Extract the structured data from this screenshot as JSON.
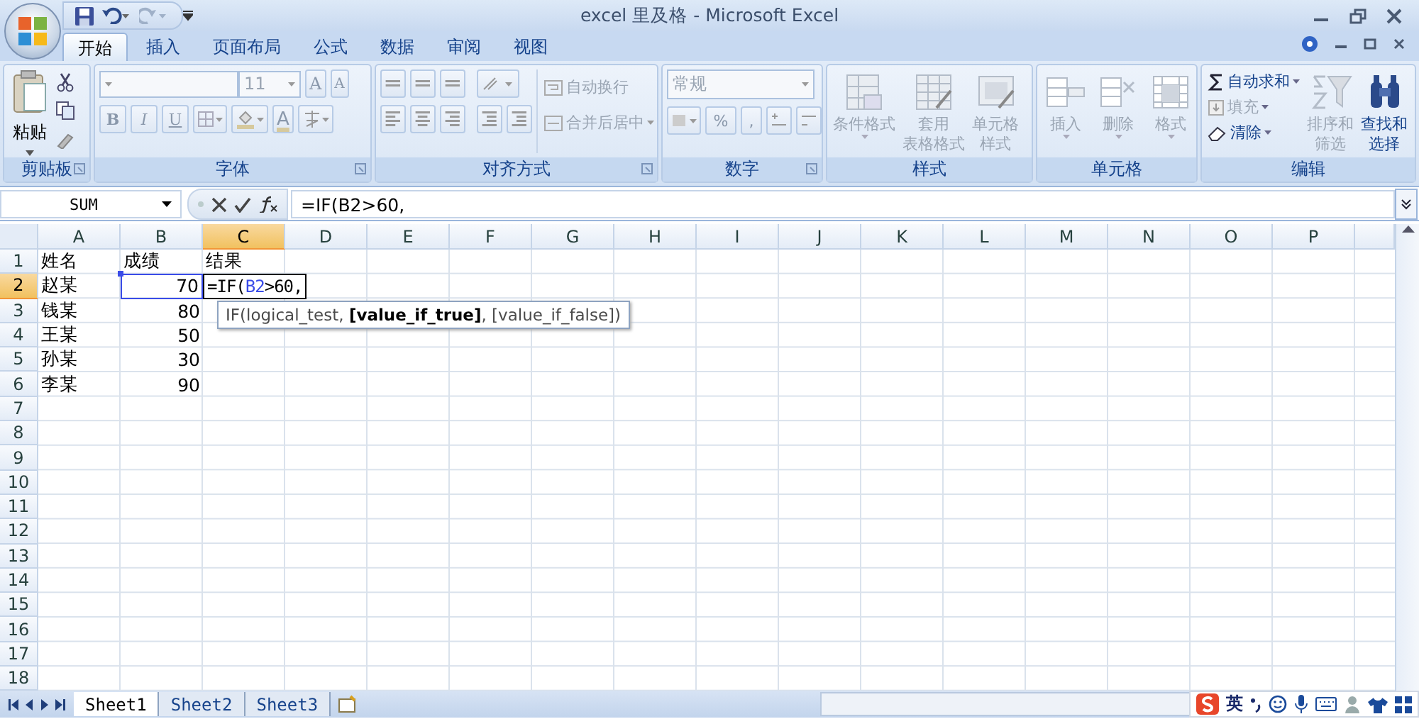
{
  "window": {
    "title": "excel 里及格 - Microsoft Excel"
  },
  "tabs": [
    {
      "label": "开始",
      "selected": true
    },
    {
      "label": "插入",
      "selected": false
    },
    {
      "label": "页面布局",
      "selected": false
    },
    {
      "label": "公式",
      "selected": false
    },
    {
      "label": "数据",
      "selected": false
    },
    {
      "label": "审阅",
      "selected": false
    },
    {
      "label": "视图",
      "selected": false
    }
  ],
  "ribbon": [
    {
      "kind": "clipboard",
      "title": "剪贴板",
      "paste": "粘贴"
    },
    {
      "kind": "font",
      "title": "字体",
      "font_size": "11",
      "size_buttons": [
        "A",
        "A"
      ],
      "style_buttons": [
        "B",
        "I",
        "U"
      ],
      "font_color": "A"
    },
    {
      "kind": "alignment",
      "title": "对齐方式",
      "wrap": {
        "label": "自动换行",
        "disabled": true
      },
      "merge": {
        "label": "合并后居中",
        "disabled": true
      }
    },
    {
      "kind": "number",
      "title": "数字",
      "format": "常规",
      "buttons": [
        "%",
        ","
      ]
    },
    {
      "kind": "large",
      "title": "样式",
      "items": [
        {
          "lines": [
            "条件格式"
          ],
          "disabled": true
        },
        {
          "lines": [
            "套用",
            "表格格式"
          ],
          "disabled": true
        },
        {
          "lines": [
            "单元格",
            "样式"
          ],
          "disabled": true
        }
      ]
    },
    {
      "kind": "large",
      "title": "单元格",
      "items": [
        {
          "lines": [
            "插入"
          ],
          "disabled": true
        },
        {
          "lines": [
            "删除"
          ],
          "disabled": true
        },
        {
          "lines": [
            "格式"
          ],
          "disabled": true
        }
      ]
    },
    {
      "kind": "editing",
      "title": "编辑",
      "small": [
        {
          "label": "自动求和",
          "disabled": false
        },
        {
          "label": "填充",
          "disabled": true
        },
        {
          "label": "清除",
          "disabled": false
        }
      ],
      "large": [
        {
          "lines": [
            "排序和",
            "筛选"
          ],
          "disabled": true
        },
        {
          "lines": [
            "查找和",
            "选择"
          ],
          "disabled": false
        }
      ]
    }
  ],
  "formula_bar": {
    "name_box": "SUM",
    "formula": "=IF(B2>60,"
  },
  "columns": [
    {
      "label": "A",
      "selected": false
    },
    {
      "label": "B",
      "selected": false
    },
    {
      "label": "C",
      "selected": true
    },
    {
      "label": "D",
      "selected": false
    },
    {
      "label": "E",
      "selected": false
    },
    {
      "label": "F",
      "selected": false
    },
    {
      "label": "G",
      "selected": false
    },
    {
      "label": "H",
      "selected": false
    },
    {
      "label": "I",
      "selected": false
    },
    {
      "label": "J",
      "selected": false
    },
    {
      "label": "K",
      "selected": false
    },
    {
      "label": "L",
      "selected": false
    },
    {
      "label": "M",
      "selected": false
    },
    {
      "label": "N",
      "selected": false
    },
    {
      "label": "O",
      "selected": false
    },
    {
      "label": "P",
      "selected": false
    }
  ],
  "rows": [
    {
      "number": "1",
      "selected": false,
      "cells": [
        {
          "kind": "text",
          "text": "姓名"
        },
        {
          "kind": "text",
          "text": "成绩"
        },
        {
          "kind": "text",
          "text": "结果"
        }
      ]
    },
    {
      "number": "2",
      "selected": true,
      "cells": [
        {
          "kind": "text",
          "text": "赵某"
        },
        {
          "kind": "number",
          "text": "70",
          "highlighted": true
        },
        {
          "kind": "formula",
          "segments": [
            {
              "text": "=IF(",
              "ref": false
            },
            {
              "text": "B2",
              "ref": true
            },
            {
              "text": ">60,",
              "ref": false
            }
          ]
        }
      ]
    },
    {
      "number": "3",
      "selected": false,
      "cells": [
        {
          "kind": "text",
          "text": "钱某"
        },
        {
          "kind": "number",
          "text": "80"
        }
      ]
    },
    {
      "number": "4",
      "selected": false,
      "cells": [
        {
          "kind": "text",
          "text": "王某"
        },
        {
          "kind": "number",
          "text": "50"
        }
      ]
    },
    {
      "number": "5",
      "selected": false,
      "cells": [
        {
          "kind": "text",
          "text": "孙某"
        },
        {
          "kind": "number",
          "text": "30"
        }
      ]
    },
    {
      "number": "6",
      "selected": false,
      "cells": [
        {
          "kind": "text",
          "text": "李某"
        },
        {
          "kind": "number",
          "text": "90"
        }
      ]
    },
    {
      "number": "7",
      "selected": false,
      "cells": []
    },
    {
      "number": "8",
      "selected": false,
      "cells": []
    },
    {
      "number": "9",
      "selected": false,
      "cells": []
    },
    {
      "number": "10",
      "selected": false,
      "cells": []
    },
    {
      "number": "11",
      "selected": false,
      "cells": []
    },
    {
      "number": "12",
      "selected": false,
      "cells": []
    },
    {
      "number": "13",
      "selected": false,
      "cells": []
    },
    {
      "number": "14",
      "selected": false,
      "cells": []
    },
    {
      "number": "15",
      "selected": false,
      "cells": []
    },
    {
      "number": "16",
      "selected": false,
      "cells": []
    },
    {
      "number": "17",
      "selected": false,
      "cells": []
    },
    {
      "number": "18",
      "selected": false,
      "cells": []
    }
  ],
  "tooltip": "IF(logical_test, **[value_if_true]**, [value_if_false])",
  "sheets": [
    {
      "label": "Sheet1",
      "selected": true
    },
    {
      "label": "Sheet2",
      "selected": false
    },
    {
      "label": "Sheet3",
      "selected": false
    }
  ],
  "ime": {
    "language": "英"
  }
}
